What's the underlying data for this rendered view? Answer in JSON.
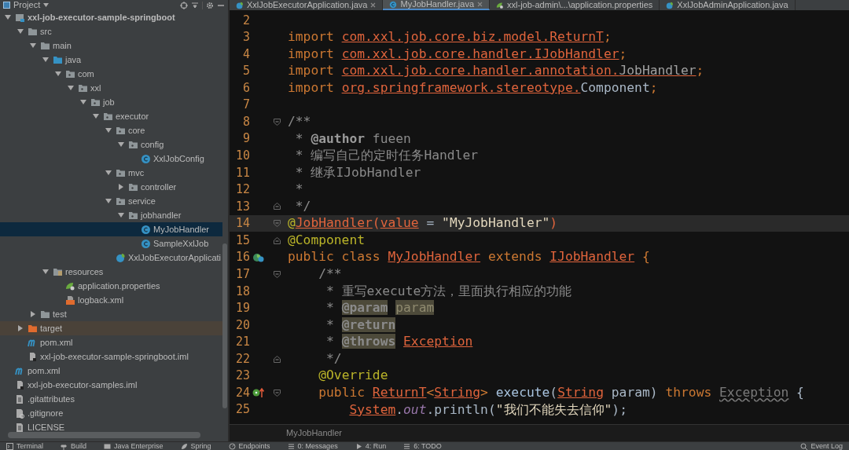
{
  "project_panel": {
    "title": "Project"
  },
  "tree": [
    {
      "label": "xxl-job-executor-sample-springboot",
      "kind": "module",
      "expanded": true,
      "selected": false,
      "children": [
        {
          "label": "src",
          "kind": "folder",
          "expanded": true,
          "selected": false,
          "children": [
            {
              "label": "main",
              "kind": "folder",
              "expanded": true,
              "selected": false,
              "children": [
                {
                  "label": "java",
                  "kind": "source-folder",
                  "expanded": true,
                  "selected": false,
                  "children": [
                    {
                      "label": "com",
                      "kind": "package",
                      "expanded": true,
                      "selected": false,
                      "children": [
                        {
                          "label": "xxl",
                          "kind": "package",
                          "expanded": true,
                          "selected": false,
                          "children": [
                            {
                              "label": "job",
                              "kind": "package",
                              "expanded": true,
                              "selected": false,
                              "children": [
                                {
                                  "label": "executor",
                                  "kind": "package",
                                  "expanded": true,
                                  "selected": false,
                                  "children": [
                                    {
                                      "label": "core",
                                      "kind": "package",
                                      "expanded": true,
                                      "selected": false,
                                      "children": [
                                        {
                                          "label": "config",
                                          "kind": "package",
                                          "expanded": true,
                                          "selected": false,
                                          "children": [
                                            {
                                              "label": "XxlJobConfig",
                                              "kind": "class",
                                              "selected": false
                                            }
                                          ]
                                        }
                                      ]
                                    },
                                    {
                                      "label": "mvc",
                                      "kind": "package",
                                      "expanded": true,
                                      "selected": false,
                                      "children": [
                                        {
                                          "label": "controller",
                                          "kind": "package",
                                          "expanded": false,
                                          "selected": false
                                        }
                                      ]
                                    },
                                    {
                                      "label": "service",
                                      "kind": "package",
                                      "expanded": true,
                                      "selected": false,
                                      "children": [
                                        {
                                          "label": "jobhandler",
                                          "kind": "package",
                                          "expanded": true,
                                          "selected": false,
                                          "children": [
                                            {
                                              "label": "MyJobHandler",
                                              "kind": "class",
                                              "selected": true
                                            },
                                            {
                                              "label": "SampleXxlJob",
                                              "kind": "class",
                                              "selected": false
                                            }
                                          ]
                                        }
                                      ]
                                    },
                                    {
                                      "label": "XxlJobExecutorApplicati",
                                      "kind": "spring-class",
                                      "selected": false
                                    }
                                  ]
                                }
                              ]
                            }
                          ]
                        }
                      ]
                    }
                  ]
                },
                {
                  "label": "resources",
                  "kind": "resources-folder",
                  "expanded": true,
                  "selected": false,
                  "children": [
                    {
                      "label": "application.properties",
                      "kind": "properties",
                      "selected": false
                    },
                    {
                      "label": "logback.xml",
                      "kind": "xml",
                      "selected": false
                    }
                  ]
                }
              ]
            },
            {
              "label": "test",
              "kind": "folder",
              "expanded": false,
              "selected": false
            }
          ]
        },
        {
          "label": "target",
          "kind": "excluded-folder",
          "expanded": false,
          "selected": false
        },
        {
          "label": "pom.xml",
          "kind": "maven",
          "selected": false
        },
        {
          "label": "xxl-job-executor-sample-springboot.iml",
          "kind": "iml",
          "selected": false
        }
      ]
    },
    {
      "label": "pom.xml",
      "kind": "maven",
      "selected": false
    },
    {
      "label": "xxl-job-executor-samples.iml",
      "kind": "iml",
      "selected": false
    },
    {
      "label": ".gitattributes",
      "kind": "text",
      "selected": false
    },
    {
      "label": ".gitignore",
      "kind": "ignore",
      "selected": false
    },
    {
      "label": "LICENSE",
      "kind": "text",
      "selected": false
    }
  ],
  "tabs": [
    {
      "label": "XxlJobExecutorApplication.java",
      "kind": "spring-class",
      "selected": false,
      "closable": true
    },
    {
      "label": "MyJobHandler.java",
      "kind": "class",
      "selected": true,
      "closable": true
    },
    {
      "label": "xxl-job-admin\\...\\application.properties",
      "kind": "properties",
      "selected": false,
      "closable": false
    },
    {
      "label": "XxlJobAdminApplication.java",
      "kind": "spring-class",
      "selected": false,
      "closable": false
    }
  ],
  "editor": {
    "lines": [
      {
        "number": "2",
        "current": false
      },
      {
        "number": "3",
        "current": false,
        "tokens": [
          {
            "kind": "kw",
            "text": "import "
          },
          {
            "kind": "ref",
            "text": "com.xxl.job.core.biz.model.ReturnT"
          },
          {
            "kind": "kw",
            "text": ";"
          }
        ]
      },
      {
        "number": "4",
        "current": false,
        "tokens": [
          {
            "kind": "kw",
            "text": "import "
          },
          {
            "kind": "ref",
            "text": "com.xxl.job.core.handler.IJobHandler"
          },
          {
            "kind": "kw",
            "text": ";"
          }
        ]
      },
      {
        "number": "5",
        "current": false,
        "tokens": [
          {
            "kind": "kw",
            "text": "import "
          },
          {
            "kind": "ref",
            "text": "com.xxl.job.core.handler.annotation."
          },
          {
            "kind": "refdim",
            "text": "JobHandler"
          },
          {
            "kind": "kw",
            "text": ";"
          }
        ]
      },
      {
        "number": "6",
        "current": false,
        "tokens": [
          {
            "kind": "kw",
            "text": "import "
          },
          {
            "kind": "ref",
            "text": "org.springframework.stereotype."
          },
          {
            "kind": "plain",
            "text": "Component"
          },
          {
            "kind": "kw",
            "text": ";"
          }
        ]
      },
      {
        "number": "7",
        "current": false
      },
      {
        "number": "8",
        "current": false,
        "gutter_icons": [
          {
            "kind": "fold-start"
          }
        ],
        "tokens": [
          {
            "kind": "comment",
            "text": "/**"
          }
        ]
      },
      {
        "number": "9",
        "current": false,
        "tokens": [
          {
            "kind": "comment",
            "text": " * "
          },
          {
            "kind": "ctag",
            "text": "@author"
          },
          {
            "kind": "comment",
            "text": " fueen"
          }
        ]
      },
      {
        "number": "10",
        "current": false,
        "tokens": [
          {
            "kind": "comment",
            "text": " * 编写自己的定时任务Handler"
          }
        ]
      },
      {
        "number": "11",
        "current": false,
        "tokens": [
          {
            "kind": "comment",
            "text": " * 继承IJobHandler"
          }
        ]
      },
      {
        "number": "12",
        "current": false,
        "tokens": [
          {
            "kind": "comment",
            "text": " *"
          }
        ]
      },
      {
        "number": "13",
        "current": false,
        "gutter_icons": [
          {
            "kind": "fold-end"
          }
        ],
        "tokens": [
          {
            "kind": "comment",
            "text": " */"
          }
        ]
      },
      {
        "number": "14",
        "current": true,
        "gutter_icons": [
          {
            "kind": "fold-start"
          }
        ],
        "tokens": [
          {
            "kind": "ann",
            "text": "@"
          },
          {
            "kind": "ref",
            "text": "JobHandler"
          },
          {
            "kind": "annp",
            "text": "("
          },
          {
            "kind": "ref",
            "text": "value"
          },
          {
            "kind": "plain",
            "text": " = "
          },
          {
            "kind": "string",
            "text": "\"MyJobHandler\""
          },
          {
            "kind": "annp",
            "text": ")"
          }
        ]
      },
      {
        "number": "15",
        "current": false,
        "gutter_icons": [
          {
            "kind": "fold-end"
          }
        ],
        "tokens": [
          {
            "kind": "ann",
            "text": "@Component"
          }
        ]
      },
      {
        "number": "16",
        "current": false,
        "gutter_icons": [
          {
            "kind": "bean"
          }
        ],
        "tokens": [
          {
            "kind": "kw",
            "text": "public class "
          },
          {
            "kind": "ref",
            "text": "MyJobHandler"
          },
          {
            "kind": "kw",
            "text": " extends "
          },
          {
            "kind": "ref",
            "text": "IJobHandler"
          },
          {
            "kind": "kw",
            "text": " {"
          }
        ]
      },
      {
        "number": "17",
        "current": false,
        "gutter_icons": [
          {
            "kind": "fold-start"
          }
        ],
        "tokens": [
          {
            "kind": "comment",
            "text": "    /**"
          }
        ]
      },
      {
        "number": "18",
        "current": false,
        "tokens": [
          {
            "kind": "comment",
            "text": "     * 重写execute方法，里面执行相应的功能"
          }
        ]
      },
      {
        "number": "19",
        "current": false,
        "tokens": [
          {
            "kind": "comment",
            "text": "     * "
          },
          {
            "kind": "ctaghl",
            "text": "@param"
          },
          {
            "kind": "paramhl",
            "text": " param"
          }
        ]
      },
      {
        "number": "20",
        "current": false,
        "tokens": [
          {
            "kind": "comment",
            "text": "     * "
          },
          {
            "kind": "ctaghl",
            "text": "@return"
          }
        ]
      },
      {
        "number": "21",
        "current": false,
        "tokens": [
          {
            "kind": "comment",
            "text": "     * "
          },
          {
            "kind": "ctaghl",
            "text": "@throws"
          },
          {
            "kind": "ref",
            "text": " Exception"
          }
        ]
      },
      {
        "number": "22",
        "current": false,
        "gutter_icons": [
          {
            "kind": "fold-end"
          }
        ],
        "tokens": [
          {
            "kind": "comment",
            "text": "     */"
          }
        ]
      },
      {
        "number": "23",
        "current": false,
        "tokens": [
          {
            "kind": "ann",
            "text": "    @Override"
          }
        ]
      },
      {
        "number": "24",
        "current": false,
        "gutter_icons": [
          {
            "kind": "override"
          },
          {
            "kind": "fold-start"
          }
        ],
        "tokens": [
          {
            "kind": "kw",
            "text": "    public "
          },
          {
            "kind": "ref",
            "text": "ReturnT"
          },
          {
            "kind": "kw",
            "text": "<"
          },
          {
            "kind": "ref",
            "text": "String"
          },
          {
            "kind": "kw",
            "text": "> "
          },
          {
            "kind": "method",
            "text": "execute"
          },
          {
            "kind": "plain",
            "text": "("
          },
          {
            "kind": "ref",
            "text": "String"
          },
          {
            "kind": "plain",
            "text": " param) "
          },
          {
            "kind": "kw",
            "text": "throws "
          },
          {
            "kind": "dim",
            "text": "Exception"
          },
          {
            "kind": "plain",
            "text": " {"
          }
        ]
      },
      {
        "number": "25",
        "current": false,
        "tokens": [
          {
            "kind": "ref",
            "text": "        System"
          },
          {
            "kind": "plain",
            "text": "."
          },
          {
            "kind": "field",
            "text": "out"
          },
          {
            "kind": "plain",
            "text": ".println("
          },
          {
            "kind": "string",
            "text": "\"我们不能失去信仰\""
          },
          {
            "kind": "plain",
            "text": ");"
          }
        ]
      }
    ]
  },
  "breadcrumb": "MyJobHandler",
  "tool_windows": {
    "left": [
      {
        "label": "Terminal",
        "kind": "terminal"
      },
      {
        "label": "Build",
        "kind": "hammer"
      },
      {
        "label": "Java Enterprise",
        "kind": "window"
      },
      {
        "label": "Spring",
        "kind": "leaf"
      },
      {
        "label": "Endpoints",
        "kind": "gauge"
      },
      {
        "label": "0: Messages",
        "kind": "list"
      },
      {
        "label": "4: Run",
        "kind": "play"
      },
      {
        "label": "6: TODO",
        "kind": "list"
      }
    ],
    "right": [
      {
        "label": "Event Log",
        "kind": "search"
      }
    ]
  }
}
